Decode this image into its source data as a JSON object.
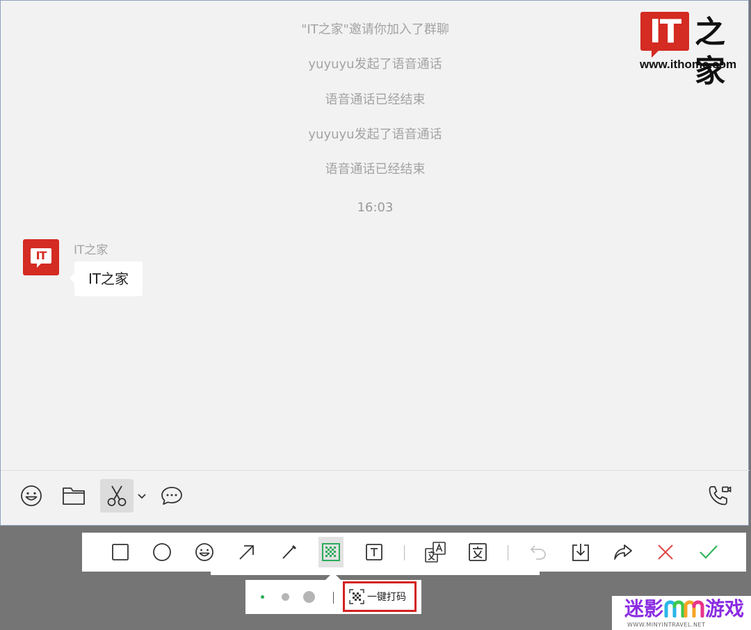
{
  "system_messages": [
    "\"IT之家\"邀请你加入了群聊",
    "yuyuyu发起了语音通话",
    "语音通话已经结束",
    "yuyuyu发起了语音通话",
    "语音通话已经结束"
  ],
  "timestamp": "16:03",
  "message": {
    "sender": "IT之家",
    "avatar_text": "IT",
    "text": "IT之家"
  },
  "watermark": {
    "logo_text": "IT",
    "logo_chinese": "之家",
    "url": "www.ithome.com"
  },
  "chat_toolbar": {
    "icons": [
      "emoji-icon",
      "folder-icon",
      "scissors-icon",
      "chevron-down-icon",
      "chat-bubble-icon",
      "phone-video-icon"
    ]
  },
  "annotation_toolbar": {
    "tools": [
      "rectangle",
      "ellipse",
      "emoji",
      "arrow",
      "pen",
      "mosaic",
      "text",
      "translate",
      "extract-text",
      "undo",
      "save",
      "share",
      "cancel",
      "confirm"
    ],
    "selected": "mosaic"
  },
  "mosaic_options": {
    "one_click_label": "一键打码"
  },
  "corner_brand": {
    "name_part1": "迷影",
    "name_part2": "游戏",
    "url": "WWW.MINYINTRAVEL.NET"
  },
  "colors": {
    "brand_red": "#d42b22",
    "selected_green": "#2aad5b",
    "cancel_red": "#e04444",
    "confirm_green": "#2fb45a",
    "chat_bg": "#f2f2f2",
    "page_bg": "#757575"
  }
}
